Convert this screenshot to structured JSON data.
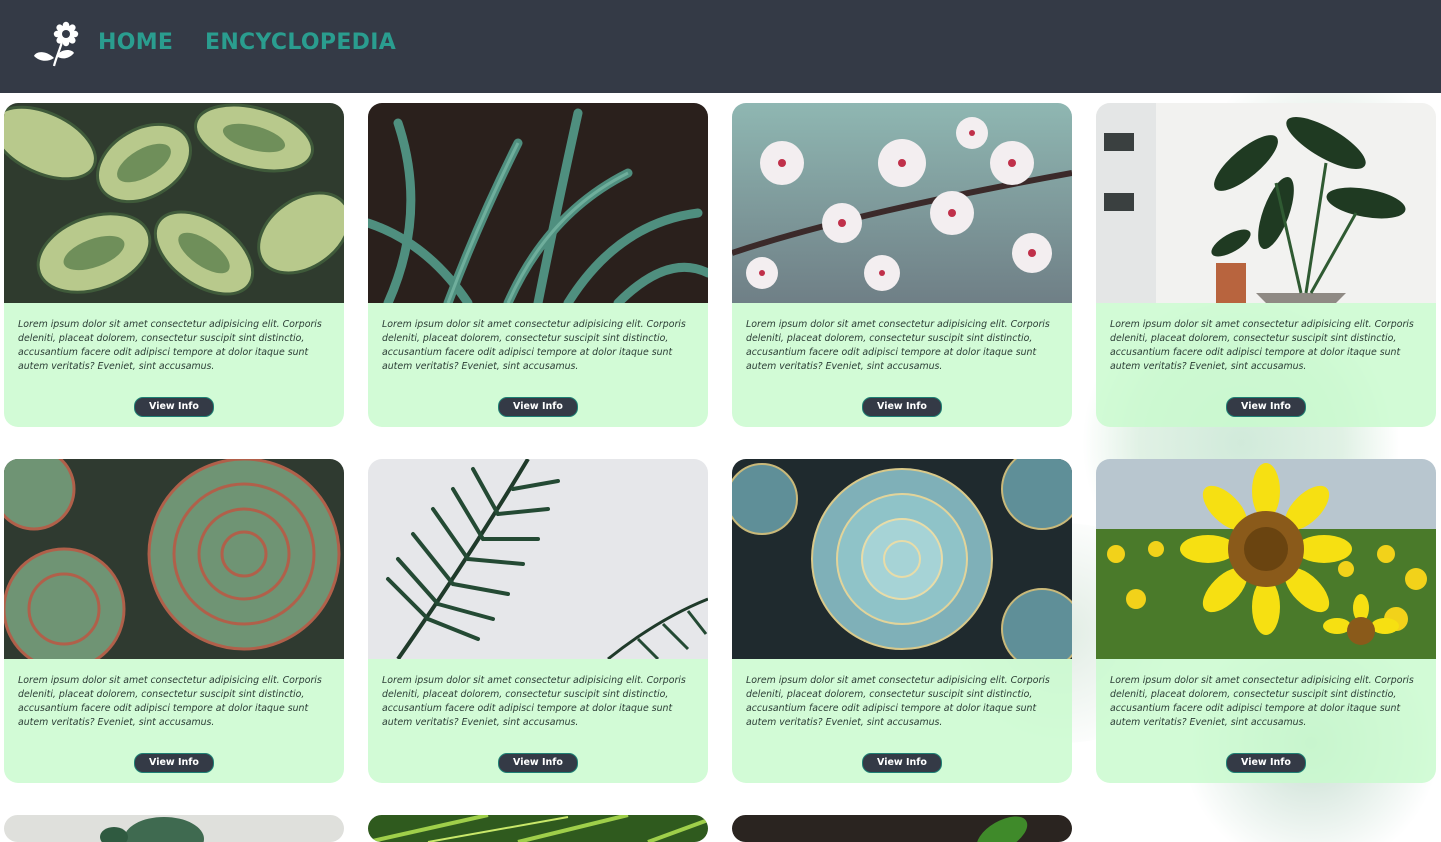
{
  "header": {
    "logo_icon": "flower-logo-icon",
    "nav": [
      {
        "label": "HOME"
      },
      {
        "label": "ENCYCLOPEDIA"
      }
    ],
    "colors": {
      "background": "#343a46",
      "link": "#2a9d8f"
    }
  },
  "cards": [
    {
      "image": "hosta-leaves-photo",
      "description": "Lorem ipsum dolor sit amet consectetur adipisicing elit. Corporis deleniti, placeat dolorem, consectetur suscipit sint distinctio, accusantium facere odit adipisci tempore at dolor itaque sunt autem veritatis? Eveniet, sint accusamus.",
      "button": "View Info"
    },
    {
      "image": "aloe-leaves-photo",
      "description": "Lorem ipsum dolor sit amet consectetur adipisicing elit. Corporis deleniti, placeat dolorem, consectetur suscipit sint distinctio, accusantium facere odit adipisci tempore at dolor itaque sunt autem veritatis? Eveniet, sint accusamus.",
      "button": "View Info"
    },
    {
      "image": "cherry-blossom-photo",
      "description": "Lorem ipsum dolor sit amet consectetur adipisicing elit. Corporis deleniti, placeat dolorem, consectetur suscipit sint distinctio, accusantium facere odit adipisci tempore at dolor itaque sunt autem veritatis? Eveniet, sint accusamus.",
      "button": "View Info"
    },
    {
      "image": "potted-bird-of-paradise-photo",
      "description": "Lorem ipsum dolor sit amet consectetur adipisicing elit. Corporis deleniti, placeat dolorem, consectetur suscipit sint distinctio, accusantium facere odit adipisci tempore at dolor itaque sunt autem veritatis? Eveniet, sint accusamus.",
      "button": "View Info"
    },
    {
      "image": "red-edged-succulent-photo",
      "description": "Lorem ipsum dolor sit amet consectetur adipisicing elit. Corporis deleniti, placeat dolorem, consectetur suscipit sint distinctio, accusantium facere odit adipisci tempore at dolor itaque sunt autem veritatis? Eveniet, sint accusamus.",
      "button": "View Info"
    },
    {
      "image": "palm-frond-photo",
      "description": "Lorem ipsum dolor sit amet consectetur adipisicing elit. Corporis deleniti, placeat dolorem, consectetur suscipit sint distinctio, accusantium facere odit adipisci tempore at dolor itaque sunt autem veritatis? Eveniet, sint accusamus.",
      "button": "View Info"
    },
    {
      "image": "blue-echeveria-photo",
      "description": "Lorem ipsum dolor sit amet consectetur adipisicing elit. Corporis deleniti, placeat dolorem, consectetur suscipit sint distinctio, accusantium facere odit adipisci tempore at dolor itaque sunt autem veritatis? Eveniet, sint accusamus.",
      "button": "View Info"
    },
    {
      "image": "sunflower-field-photo",
      "description": "Lorem ipsum dolor sit amet consectetur adipisicing elit. Corporis deleniti, placeat dolorem, consectetur suscipit sint distinctio, accusantium facere odit adipisci tempore at dolor itaque sunt autem veritatis? Eveniet, sint accusamus.",
      "button": "View Info"
    },
    {
      "image": "round-leaf-plant-photo"
    },
    {
      "image": "green-leaf-closeup-photo"
    },
    {
      "image": "dark-soil-sprout-photo"
    }
  ],
  "colors": {
    "card_body": "#c8facd",
    "button_bg": "#343a46",
    "button_border": "#1e7f74"
  }
}
